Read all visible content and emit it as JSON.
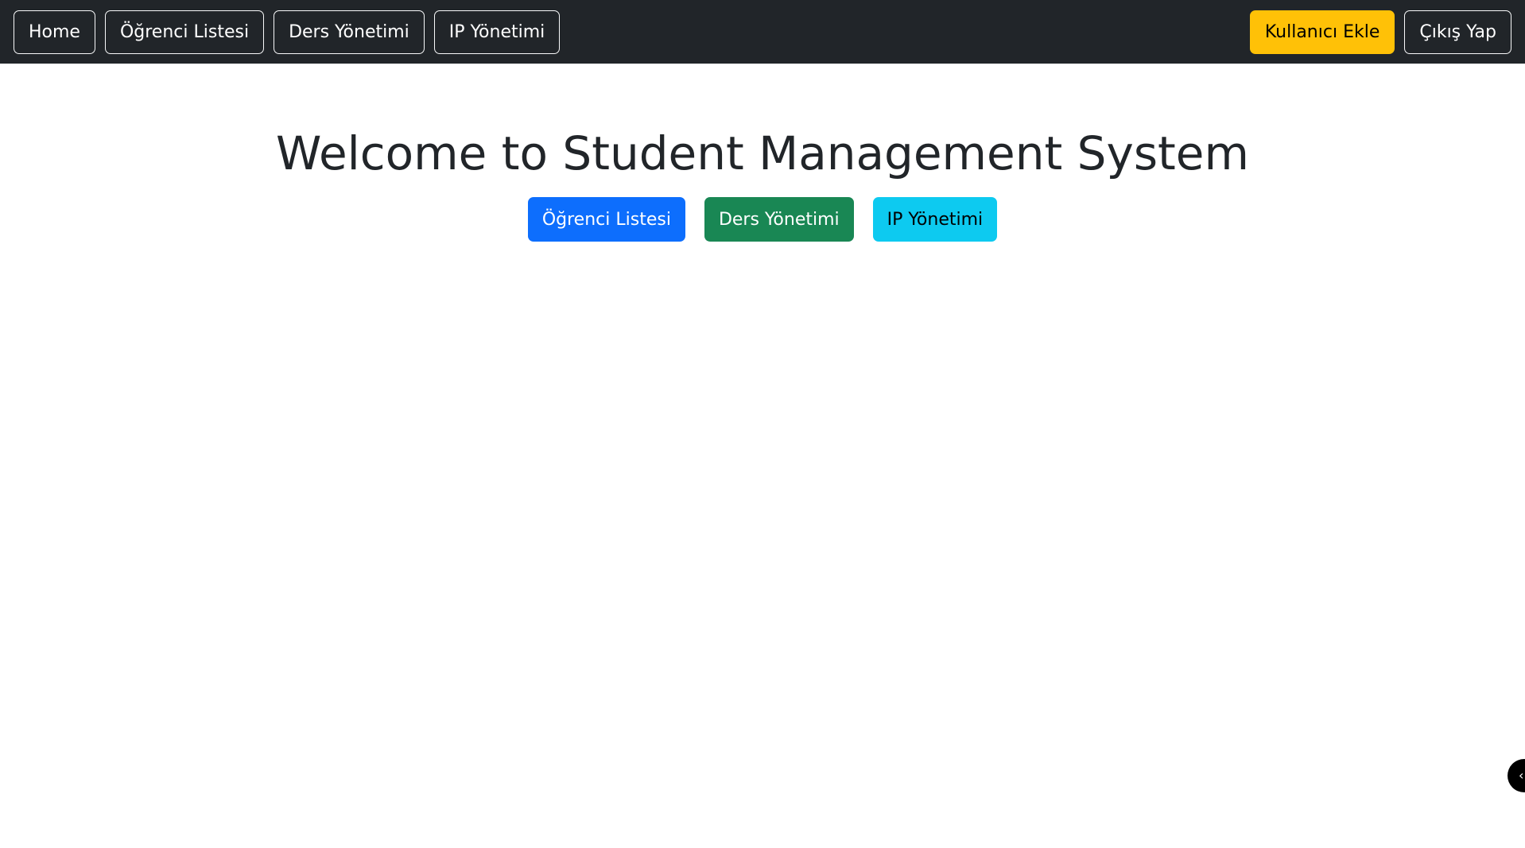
{
  "navbar": {
    "left_items": [
      {
        "label": "Home"
      },
      {
        "label": "Öğrenci Listesi"
      },
      {
        "label": "Ders Yönetimi"
      },
      {
        "label": "IP Yönetimi"
      }
    ],
    "right_items": [
      {
        "label": "Kullanıcı Ekle"
      },
      {
        "label": "Çıkış Yap"
      }
    ]
  },
  "main": {
    "title": "Welcome to Student Management System",
    "actions": [
      {
        "label": "Öğrenci Listesi"
      },
      {
        "label": "Ders Yönetimi"
      },
      {
        "label": "IP Yönetimi"
      }
    ]
  },
  "floating_toggle": {
    "icon": "chevron-left-icon"
  },
  "colors": {
    "navbar_bg": "#212529",
    "warning": "#ffc107",
    "primary": "#0d6efd",
    "success": "#198754",
    "info": "#0dcaf0"
  }
}
